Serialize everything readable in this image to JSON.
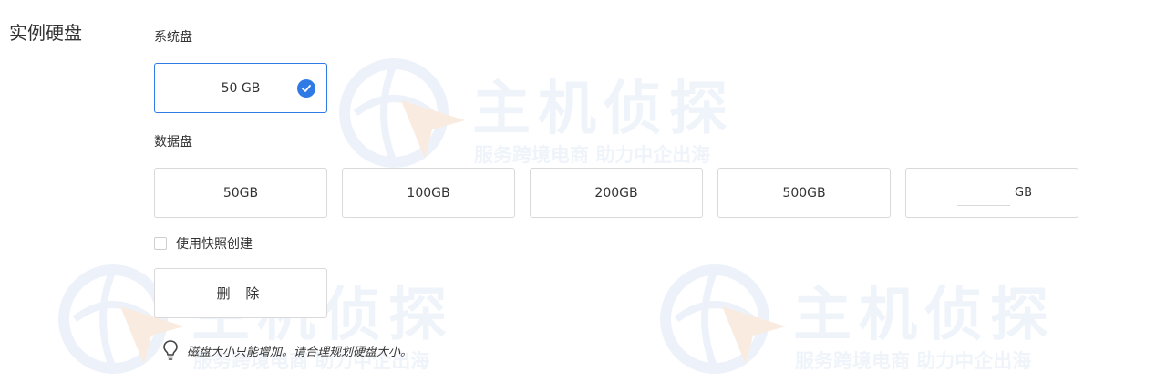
{
  "section": {
    "title": "实例硬盘"
  },
  "system_disk": {
    "label": "系统盘",
    "option": "50 GB",
    "selected": true
  },
  "data_disk": {
    "label": "数据盘",
    "options": [
      "50GB",
      "100GB",
      "200GB",
      "500GB"
    ],
    "custom": {
      "value": "",
      "unit": "GB"
    }
  },
  "snapshot": {
    "label": "使用快照创建",
    "checked": false
  },
  "delete_button": {
    "label": "删 除"
  },
  "tip": {
    "icon": "lightbulb-icon",
    "text": "磁盘大小只能增加。请合理规划硬盘大小。"
  },
  "watermark": {
    "title": "主机侦探",
    "subtitle": "服务跨境电商 助力中企出海"
  },
  "colors": {
    "accent": "#2f7ae5",
    "border": "#d9d9d9",
    "watermark": "#e3ecf7",
    "watermark_accent": "#f7dcc8"
  }
}
